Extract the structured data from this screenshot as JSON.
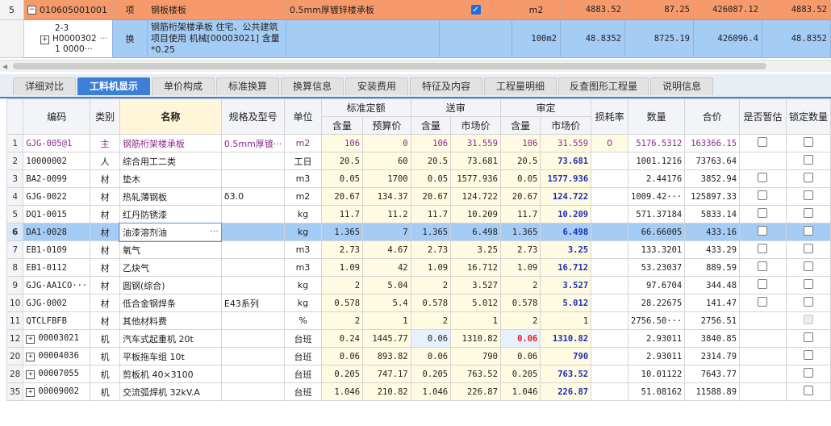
{
  "top_rows": [
    {
      "row": "5",
      "code": "010605001001",
      "type": "项",
      "name": "钢板楼板",
      "spec": "0.5mm厚镀锌楼承板",
      "checked": true,
      "unit": "m2",
      "v1": "4883.52",
      "v2": "87.25",
      "v3": "426087.12",
      "v4": "4883.52"
    },
    {
      "row": "",
      "code_l1": "2-3",
      "code_l2": "H0000302",
      "code_l3": "1  0000···",
      "type": "换",
      "name": "钢筋桁架楼承板  住宅、公共建筑项目使用 机械[00003021] 含量*0.25",
      "spec": "",
      "checked": false,
      "unit": "100m2",
      "v1": "48.8352",
      "v2": "8725.19",
      "v3": "426096.4",
      "v4": "48.8352"
    }
  ],
  "tabs": [
    "详细对比",
    "工料机显示",
    "单价构成",
    "标准换算",
    "换算信息",
    "安装费用",
    "特征及内容",
    "工程量明细",
    "反查图形工程量",
    "说明信息"
  ],
  "active_tab": 1,
  "headers": {
    "code": "编码",
    "category": "类别",
    "name": "名称",
    "spec": "规格及型号",
    "unit": "单位",
    "std_group": "标准定额",
    "sub_group": "送审",
    "rev_group": "审定",
    "qty": "含量",
    "budget_price": "预算价",
    "market_price": "市场价",
    "loss": "损耗率",
    "amount": "数量",
    "total": "合价",
    "tentative": "是否暂估",
    "lock": "锁定数量"
  },
  "rows": [
    {
      "idx": "1",
      "code": "GJG-005@1",
      "cat": "主",
      "name": "钢筋桁架楼承板",
      "spec": "0.5mm厚镀···",
      "unit": "m2",
      "s_qty": "106",
      "s_price": "0",
      "a_qty": "106",
      "a_price": "31.559",
      "v_qty": "106",
      "v_price": "31.559",
      "loss": "0",
      "amount": "5176.5312",
      "total": "163366.15",
      "tentative": true,
      "lock": true
    },
    {
      "idx": "2",
      "code": "10000002",
      "cat": "人",
      "name": "综合用工二类",
      "spec": "",
      "unit": "工日",
      "s_qty": "20.5",
      "s_price": "60",
      "a_qty": "20.5",
      "a_price": "73.681",
      "v_qty": "20.5",
      "v_price": "73.681",
      "loss": "",
      "amount": "1001.1216",
      "total": "73763.64",
      "tentative": false,
      "lock": true
    },
    {
      "idx": "3",
      "code": "BA2-0099",
      "cat": "材",
      "name": "垫木",
      "spec": "",
      "unit": "m3",
      "s_qty": "0.05",
      "s_price": "1700",
      "a_qty": "0.05",
      "a_price": "1577.936",
      "v_qty": "0.05",
      "v_price": "1577.936",
      "loss": "",
      "amount": "2.44176",
      "total": "3852.94",
      "tentative": true,
      "lock": true
    },
    {
      "idx": "4",
      "code": "GJG-0022",
      "cat": "材",
      "name": "热轧薄钢板",
      "spec": "δ3.0",
      "unit": "m2",
      "s_qty": "20.67",
      "s_price": "134.37",
      "a_qty": "20.67",
      "a_price": "124.722",
      "v_qty": "20.67",
      "v_price": "124.722",
      "loss": "",
      "amount": "1009.42···",
      "total": "125897.33",
      "tentative": true,
      "lock": true
    },
    {
      "idx": "5",
      "code": "DQ1-0015",
      "cat": "材",
      "name": "红丹防锈漆",
      "spec": "",
      "unit": "kg",
      "s_qty": "11.7",
      "s_price": "11.2",
      "a_qty": "11.7",
      "a_price": "10.209",
      "v_qty": "11.7",
      "v_price": "10.209",
      "loss": "",
      "amount": "571.37184",
      "total": "5833.14",
      "tentative": true,
      "lock": true
    },
    {
      "idx": "6",
      "code": "DA1-0028",
      "cat": "材",
      "name": "油漆溶剂油",
      "spec": "",
      "unit": "kg",
      "s_qty": "1.365",
      "s_price": "7",
      "a_qty": "1.365",
      "a_price": "6.498",
      "v_qty": "1.365",
      "v_price": "6.498",
      "loss": "",
      "amount": "66.66005",
      "total": "433.16",
      "tentative": true,
      "lock": true
    },
    {
      "idx": "7",
      "code": "EB1-0109",
      "cat": "材",
      "name": "氧气",
      "spec": "",
      "unit": "m3",
      "s_qty": "2.73",
      "s_price": "4.67",
      "a_qty": "2.73",
      "a_price": "3.25",
      "v_qty": "2.73",
      "v_price": "3.25",
      "loss": "",
      "amount": "133.3201",
      "total": "433.29",
      "tentative": true,
      "lock": true
    },
    {
      "idx": "8",
      "code": "EB1-0112",
      "cat": "材",
      "name": "乙炔气",
      "spec": "",
      "unit": "m3",
      "s_qty": "1.09",
      "s_price": "42",
      "a_qty": "1.09",
      "a_price": "16.712",
      "v_qty": "1.09",
      "v_price": "16.712",
      "loss": "",
      "amount": "53.23037",
      "total": "889.59",
      "tentative": true,
      "lock": true
    },
    {
      "idx": "9",
      "code": "GJG-AA1CO···",
      "cat": "材",
      "name": "圆钢(综合)",
      "spec": "",
      "unit": "kg",
      "s_qty": "2",
      "s_price": "5.04",
      "a_qty": "2",
      "a_price": "3.527",
      "v_qty": "2",
      "v_price": "3.527",
      "loss": "",
      "amount": "97.6704",
      "total": "344.48",
      "tentative": true,
      "lock": true
    },
    {
      "idx": "10",
      "code": "GJG-0002",
      "cat": "材",
      "name": "低合金钢焊条",
      "spec": "E43系列",
      "unit": "kg",
      "s_qty": "0.578",
      "s_price": "5.4",
      "a_qty": "0.578",
      "a_price": "5.012",
      "v_qty": "0.578",
      "v_price": "5.012",
      "loss": "",
      "amount": "28.22675",
      "total": "141.47",
      "tentative": true,
      "lock": true
    },
    {
      "idx": "11",
      "code": "QTCLFBFB",
      "cat": "材",
      "name": "其他材料费",
      "spec": "",
      "unit": "%",
      "s_qty": "2",
      "s_price": "1",
      "a_qty": "2",
      "a_price": "1",
      "v_qty": "2",
      "v_price": "1",
      "loss": "",
      "amount": "2756.50···",
      "total": "2756.51",
      "tentative": false,
      "lock": true
    },
    {
      "idx": "12",
      "code": "00003021",
      "cat": "机",
      "name": "汽车式起重机 20t",
      "spec": "",
      "unit": "台班",
      "s_qty": "0.24",
      "s_price": "1445.77",
      "a_qty": "0.06",
      "a_price": "1310.82",
      "v_qty": "0.06",
      "v_price": "1310.82",
      "loss": "",
      "amount": "2.93011",
      "total": "3840.85",
      "tentative": false,
      "lock": true
    },
    {
      "idx": "20",
      "code": "00004036",
      "cat": "机",
      "name": "平板拖车组 10t",
      "spec": "",
      "unit": "台班",
      "s_qty": "0.06",
      "s_price": "893.82",
      "a_qty": "0.06",
      "a_price": "790",
      "v_qty": "0.06",
      "v_price": "790",
      "loss": "",
      "amount": "2.93011",
      "total": "2314.79",
      "tentative": false,
      "lock": true
    },
    {
      "idx": "28",
      "code": "00007055",
      "cat": "机",
      "name": "剪板机 40×3100",
      "spec": "",
      "unit": "台班",
      "s_qty": "0.205",
      "s_price": "747.17",
      "a_qty": "0.205",
      "a_price": "763.52",
      "v_qty": "0.205",
      "v_price": "763.52",
      "loss": "",
      "amount": "10.01122",
      "total": "7643.77",
      "tentative": false,
      "lock": true
    },
    {
      "idx": "35",
      "code": "00009002",
      "cat": "机",
      "name": "交流弧焊机 32kV.A",
      "spec": "",
      "unit": "台班",
      "s_qty": "1.046",
      "s_price": "210.82",
      "a_qty": "1.046",
      "a_price": "226.87",
      "v_qty": "1.046",
      "v_price": "226.87",
      "loss": "",
      "amount": "51.08162",
      "total": "11588.89",
      "tentative": false,
      "lock": true
    }
  ]
}
